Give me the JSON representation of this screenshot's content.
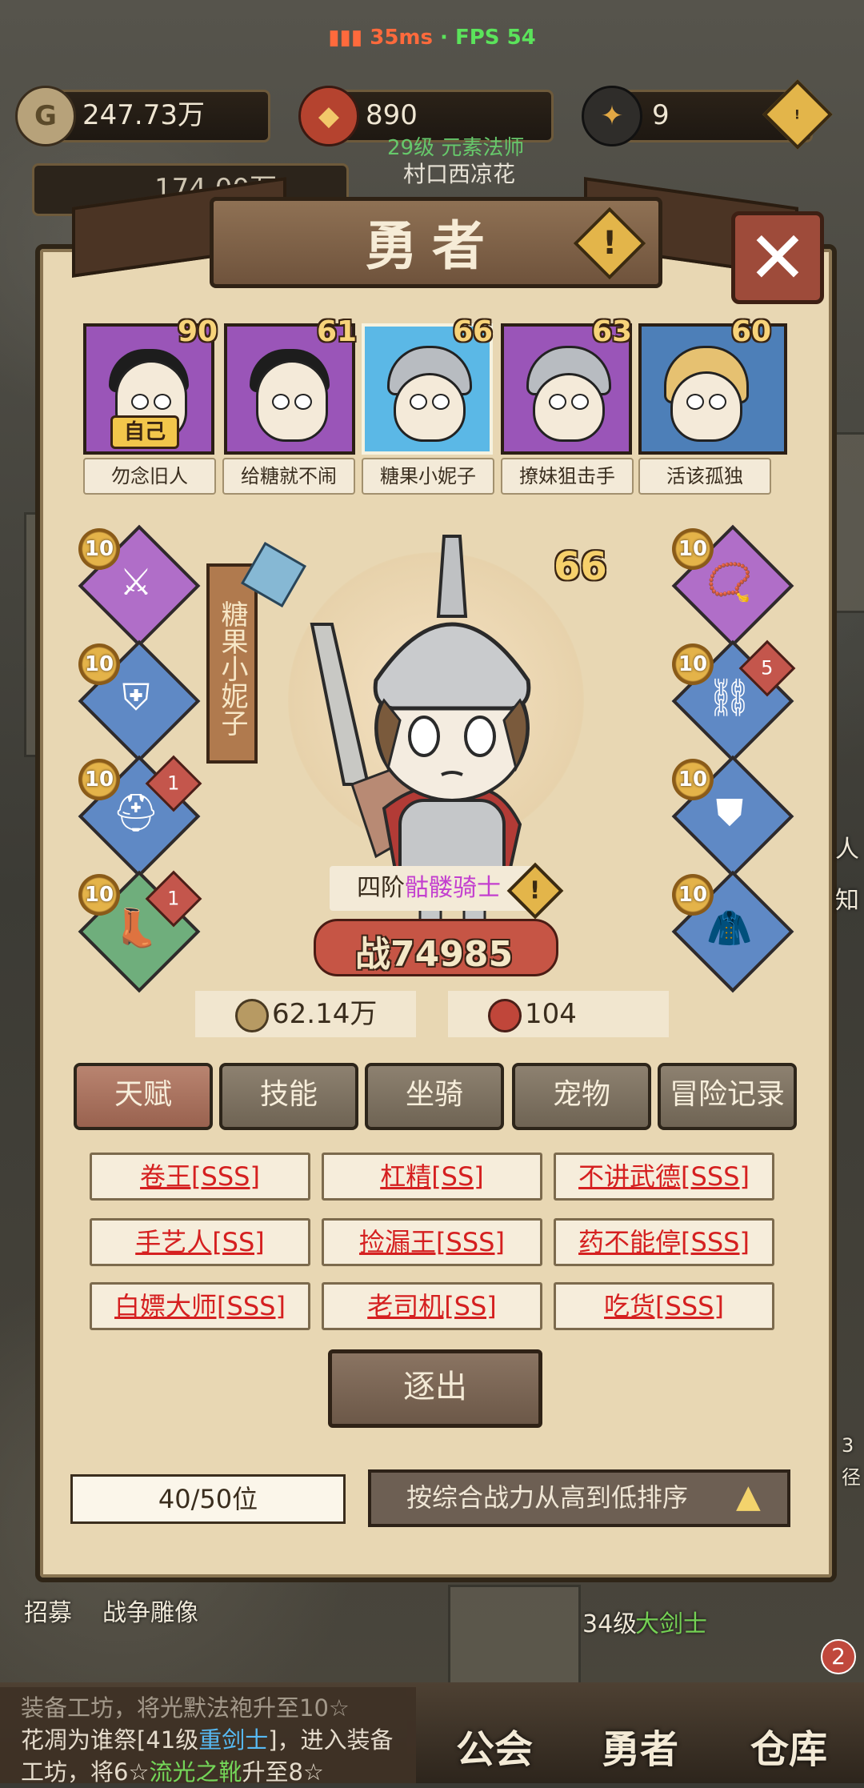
{
  "status": {
    "ping": "35ms",
    "separator": " · ",
    "fps": "FPS 54"
  },
  "resources": {
    "gold": "247.73万",
    "shield": "890",
    "gem": "9",
    "partial_hidden": "174.00万",
    "hidden_level": "29级 元素法师",
    "hidden_name": "村口西凉花"
  },
  "panel": {
    "title": "勇者",
    "close_symbol": "✕",
    "warn_symbol": "!"
  },
  "heroes": [
    {
      "level": "90",
      "name": "勿念旧人",
      "rarity_color": "#9a55b8",
      "self": "自己"
    },
    {
      "level": "61",
      "name": "给糖就不闹",
      "rarity_color": "#9a55b8"
    },
    {
      "level": "66",
      "name": "糖果小妮子",
      "rarity_color": "#5bb8e6",
      "selected": true
    },
    {
      "level": "63",
      "name": "撩妹狙击手",
      "rarity_color": "#9a55b8"
    },
    {
      "level": "60",
      "name": "活该孤独",
      "rarity_color": "#4d7fb8"
    }
  ],
  "selected_hero": {
    "vertical_name": "糖果小妮子",
    "level": "66",
    "tier": "四阶",
    "class": "骷髅骑士",
    "power_label": "战",
    "power": "74985",
    "gold_stat": "62.14万",
    "token_stat": "104"
  },
  "equipment_left": [
    {
      "level": "10",
      "rarity": "purple",
      "icon": "spear-icon"
    },
    {
      "level": "10",
      "rarity": "blue",
      "icon": "armor-icon"
    },
    {
      "level": "10",
      "rarity": "blue",
      "icon": "helmet-icon",
      "badge": "1"
    },
    {
      "level": "10",
      "rarity": "green",
      "icon": "boots-icon",
      "badge": "1"
    }
  ],
  "equipment_right": [
    {
      "level": "10",
      "rarity": "purple",
      "icon": "necklace-icon"
    },
    {
      "level": "10",
      "rarity": "blue",
      "icon": "bracer-icon",
      "badge": "5"
    },
    {
      "level": "10",
      "rarity": "blue",
      "icon": "pauldron-icon"
    },
    {
      "level": "10",
      "rarity": "blue",
      "icon": "cape-icon"
    }
  ],
  "tabs": [
    "天赋",
    "技能",
    "坐骑",
    "宠物",
    "冒险记录"
  ],
  "traits": [
    "卷王[SSS]",
    "杠精[SS]",
    "不讲武德[SSS]",
    "手艺人[SS]",
    "捡漏王[SSS]",
    "药不能停[SSS]",
    "白嫖大师[SSS]",
    "老司机[SS]",
    "吃货[SSS]"
  ],
  "expel_label": "逐出",
  "slots": "40/50位",
  "sort_label": "按综合战力从高到低排序",
  "background": {
    "recruit": "招募",
    "war_statue": "战争雕像",
    "level_label": "34级",
    "class_label": "大剑士",
    "side_chars": [
      "人",
      "知"
    ],
    "side_num": "3",
    "side_char2": "径"
  },
  "log": {
    "line1": "装备工坊，将光默法袍升至10☆",
    "line2_a": "花凋为谁祭[41级",
    "line2_b": "重剑士",
    "line2_c": "]，进入装备",
    "line3_a": "工坊，将6☆",
    "line3_b": "流光之靴",
    "line3_c": "升至8☆"
  },
  "nav": {
    "guild": "公会",
    "hero": "勇者",
    "warehouse": "仓库",
    "warehouse_badge": "2"
  },
  "colors": {
    "accent": "#e3b54a",
    "trait_text": "#d52020",
    "panel": "#e8d7b3"
  }
}
